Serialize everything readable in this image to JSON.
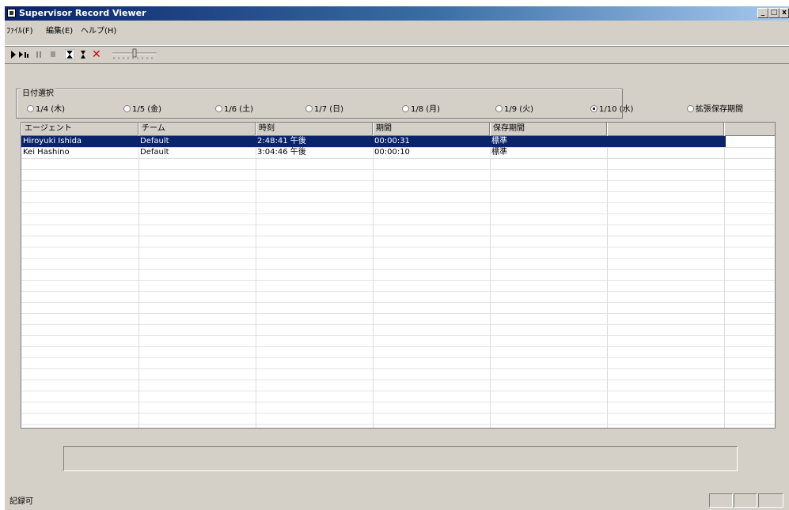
{
  "window": {
    "title": "Supervisor Record Viewer"
  },
  "title_buttons": {
    "minimize": "_",
    "maximize": "□",
    "close": "x"
  },
  "menu": [
    "ﾌｧｲﾙ(F)",
    "編集(E)",
    "ヘルプ(H)"
  ],
  "toolbar": {
    "stop_mark": "✕"
  },
  "date_group": {
    "label": "日付選択",
    "options": [
      "1/4 (木)",
      "1/5 (金)",
      "1/6 (土)",
      "1/7 (日)",
      "1/8 (月)",
      "1/9 (火)",
      "1/10 (水)",
      "拡張保存期間"
    ],
    "selected_index": 6
  },
  "table": {
    "columns": [
      "エージェント",
      "チーム",
      "時刻",
      "期間",
      "保存期間",
      ""
    ],
    "rows": [
      {
        "agent": "Hiroyuki Ishida",
        "team": "Default",
        "time": "2:48:41 午後",
        "duration": "00:00:31",
        "retention": "標準",
        "selected": true
      },
      {
        "agent": "Kei Hashino",
        "team": "Default",
        "time": "3:04:46 午後",
        "duration": "00:00:10",
        "retention": "標準",
        "selected": false
      }
    ]
  },
  "status": {
    "text": "記録可"
  }
}
